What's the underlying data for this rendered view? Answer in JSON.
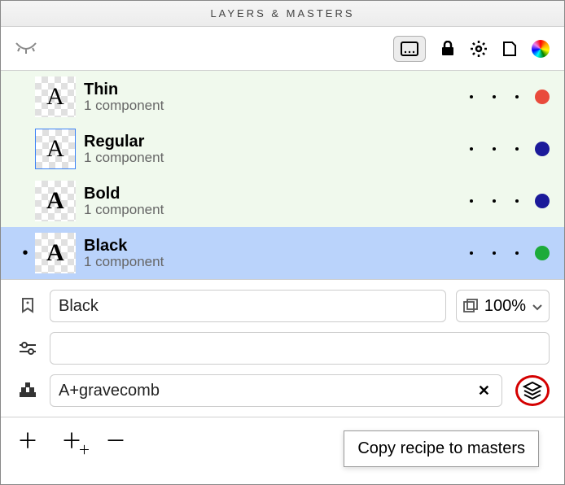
{
  "title": "LAYERS & MASTERS",
  "layers": [
    {
      "name": "Thin",
      "sub": "1 component",
      "color": "#e94b3c",
      "outlined": false,
      "leftdot": false,
      "weight": "200"
    },
    {
      "name": "Regular",
      "sub": "1 component",
      "color": "#1b1a9a",
      "outlined": true,
      "leftdot": false,
      "weight": "400"
    },
    {
      "name": "Bold",
      "sub": "1 component",
      "color": "#1b1a9a",
      "outlined": false,
      "leftdot": false,
      "weight": "700"
    },
    {
      "name": "Black",
      "sub": "1 component",
      "color": "#1dab3a",
      "outlined": false,
      "leftdot": true,
      "weight": "900",
      "selected": true
    }
  ],
  "fields": {
    "mastername": "Black",
    "scale": "100%",
    "transform": "",
    "recipe": "A+gravecomb"
  },
  "tooltip": "Copy recipe to masters"
}
